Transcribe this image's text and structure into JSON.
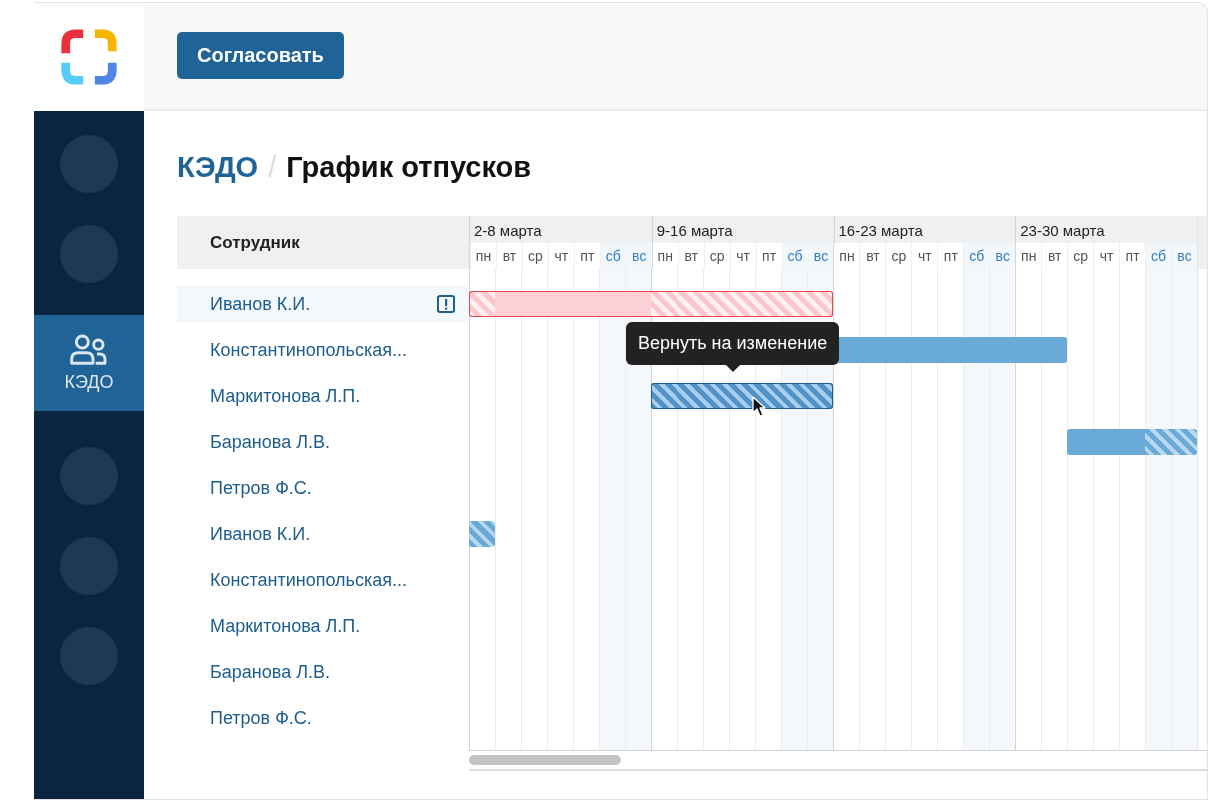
{
  "toolbar": {
    "button": "Согласовать"
  },
  "sidebar": {
    "items": [
      {
        "kind": "placeholder",
        "selected": false
      },
      {
        "kind": "placeholder",
        "selected": false
      },
      {
        "kind": "item",
        "label": "КЭДО",
        "selected": true
      },
      {
        "kind": "placeholder",
        "selected": false
      },
      {
        "kind": "placeholder",
        "selected": false
      },
      {
        "kind": "placeholder",
        "selected": false
      }
    ]
  },
  "breadcrumb": {
    "section": "КЭДО",
    "separator": "/",
    "title": "График отпусков"
  },
  "table": {
    "name_column": "Сотрудник",
    "weeks": [
      {
        "label": "2-8 марта",
        "days": [
          {
            "label": "пн",
            "weekend": false
          },
          {
            "label": "вт",
            "weekend": false
          },
          {
            "label": "ср",
            "weekend": false
          },
          {
            "label": "чт",
            "weekend": false
          },
          {
            "label": "пт",
            "weekend": false
          },
          {
            "label": "сб",
            "weekend": true
          },
          {
            "label": "вс",
            "weekend": true
          }
        ]
      },
      {
        "label": "9-16 марта",
        "days": [
          {
            "label": "пн",
            "weekend": false
          },
          {
            "label": "вт",
            "weekend": false
          },
          {
            "label": "ср",
            "weekend": false
          },
          {
            "label": "чт",
            "weekend": false
          },
          {
            "label": "пт",
            "weekend": false
          },
          {
            "label": "сб",
            "weekend": true
          },
          {
            "label": "вс",
            "weekend": true
          }
        ]
      },
      {
        "label": "16-23 марта",
        "days": [
          {
            "label": "пн",
            "weekend": false
          },
          {
            "label": "вт",
            "weekend": false
          },
          {
            "label": "ср",
            "weekend": false
          },
          {
            "label": "чт",
            "weekend": false
          },
          {
            "label": "пт",
            "weekend": false
          },
          {
            "label": "сб",
            "weekend": true
          },
          {
            "label": "вс",
            "weekend": true
          }
        ]
      },
      {
        "label": "23-30 марта",
        "days": [
          {
            "label": "пн",
            "weekend": false
          },
          {
            "label": "вт",
            "weekend": false
          },
          {
            "label": "ср",
            "weekend": false
          },
          {
            "label": "чт",
            "weekend": false
          },
          {
            "label": "пт",
            "weekend": false
          },
          {
            "label": "сб",
            "weekend": true
          },
          {
            "label": "вс",
            "weekend": true
          }
        ]
      }
    ],
    "rows": [
      {
        "name": "Иванов К.И.",
        "selected": true,
        "flagged": true,
        "conflict": true,
        "bar_selected": false,
        "cells": [
          {
            "vacation": true,
            "hatched": true
          },
          {
            "vacation": true,
            "hatched": false
          },
          {
            "vacation": true,
            "hatched": false
          },
          {
            "vacation": true,
            "hatched": false
          },
          {
            "vacation": true,
            "hatched": false
          },
          {
            "vacation": true,
            "hatched": false
          },
          {
            "vacation": true,
            "hatched": false
          },
          {
            "vacation": true,
            "hatched": true
          },
          {
            "vacation": true,
            "hatched": true
          },
          {
            "vacation": true,
            "hatched": true
          },
          {
            "vacation": true,
            "hatched": true
          },
          {
            "vacation": true,
            "hatched": true
          },
          {
            "vacation": true,
            "hatched": true
          },
          {
            "vacation": true,
            "hatched": true
          },
          {
            "vacation": false
          },
          {
            "vacation": false
          },
          {
            "vacation": false
          },
          {
            "vacation": false
          },
          {
            "vacation": false
          },
          {
            "vacation": false
          },
          {
            "vacation": false
          },
          {
            "vacation": false
          },
          {
            "vacation": false
          },
          {
            "vacation": false
          },
          {
            "vacation": false
          },
          {
            "vacation": false
          },
          {
            "vacation": false
          },
          {
            "vacation": false
          }
        ]
      },
      {
        "name": "Константинопольская...",
        "selected": false,
        "flagged": false,
        "conflict": false,
        "bar_selected": false,
        "cells": [
          {
            "vacation": false
          },
          {
            "vacation": false
          },
          {
            "vacation": false
          },
          {
            "vacation": false
          },
          {
            "vacation": false
          },
          {
            "vacation": false
          },
          {
            "vacation": false
          },
          {
            "vacation": false
          },
          {
            "vacation": false
          },
          {
            "vacation": false
          },
          {
            "vacation": false
          },
          {
            "vacation": false
          },
          {
            "vacation": false
          },
          {
            "vacation": false
          },
          {
            "vacation": true,
            "hatched": false
          },
          {
            "vacation": true,
            "hatched": false
          },
          {
            "vacation": true,
            "hatched": false
          },
          {
            "vacation": true,
            "hatched": false
          },
          {
            "vacation": true,
            "hatched": false
          },
          {
            "vacation": true,
            "hatched": false
          },
          {
            "vacation": true,
            "hatched": false
          },
          {
            "vacation": true,
            "hatched": false
          },
          {
            "vacation": true,
            "hatched": false
          },
          {
            "vacation": false
          },
          {
            "vacation": false
          },
          {
            "vacation": false
          },
          {
            "vacation": false
          },
          {
            "vacation": false
          }
        ]
      },
      {
        "name": "Маркитонова Л.П.",
        "selected": false,
        "flagged": false,
        "conflict": false,
        "bar_selected": true,
        "cells": [
          {
            "vacation": false
          },
          {
            "vacation": false
          },
          {
            "vacation": false
          },
          {
            "vacation": false
          },
          {
            "vacation": false
          },
          {
            "vacation": false
          },
          {
            "vacation": false
          },
          {
            "vacation": true,
            "hatched": true
          },
          {
            "vacation": true,
            "hatched": true
          },
          {
            "vacation": true,
            "hatched": true
          },
          {
            "vacation": true,
            "hatched": true
          },
          {
            "vacation": true,
            "hatched": true
          },
          {
            "vacation": true,
            "hatched": true
          },
          {
            "vacation": true,
            "hatched": true
          },
          {
            "vacation": false
          },
          {
            "vacation": false
          },
          {
            "vacation": false
          },
          {
            "vacation": false
          },
          {
            "vacation": false
          },
          {
            "vacation": false
          },
          {
            "vacation": false
          },
          {
            "vacation": false
          },
          {
            "vacation": false
          },
          {
            "vacation": false
          },
          {
            "vacation": false
          },
          {
            "vacation": false
          },
          {
            "vacation": false
          },
          {
            "vacation": false
          }
        ]
      },
      {
        "name": "Баранова Л.В.",
        "selected": false,
        "flagged": false,
        "conflict": false,
        "bar_selected": false,
        "cells": [
          {
            "vacation": false
          },
          {
            "vacation": false
          },
          {
            "vacation": false
          },
          {
            "vacation": false
          },
          {
            "vacation": false
          },
          {
            "vacation": false
          },
          {
            "vacation": false
          },
          {
            "vacation": false
          },
          {
            "vacation": false
          },
          {
            "vacation": false
          },
          {
            "vacation": false
          },
          {
            "vacation": false
          },
          {
            "vacation": false
          },
          {
            "vacation": false
          },
          {
            "vacation": false
          },
          {
            "vacation": false
          },
          {
            "vacation": false
          },
          {
            "vacation": false
          },
          {
            "vacation": false
          },
          {
            "vacation": false
          },
          {
            "vacation": false
          },
          {
            "vacation": false
          },
          {
            "vacation": false
          },
          {
            "vacation": true,
            "hatched": false
          },
          {
            "vacation": true,
            "hatched": false
          },
          {
            "vacation": true,
            "hatched": false
          },
          {
            "vacation": true,
            "hatched": true
          },
          {
            "vacation": true,
            "hatched": true
          }
        ]
      },
      {
        "name": "Петров Ф.С.",
        "selected": false,
        "flagged": false
      },
      {
        "name": "Иванов К.И.",
        "selected": false,
        "flagged": false,
        "conflict": false,
        "bar_selected": false,
        "cells": [
          {
            "vacation": true,
            "hatched": true
          },
          {
            "vacation": false
          },
          {
            "vacation": false
          },
          {
            "vacation": false
          },
          {
            "vacation": false
          },
          {
            "vacation": false
          },
          {
            "vacation": false
          },
          {
            "vacation": false
          },
          {
            "vacation": false
          },
          {
            "vacation": false
          },
          {
            "vacation": false
          },
          {
            "vacation": false
          },
          {
            "vacation": false
          },
          {
            "vacation": false
          },
          {
            "vacation": false
          },
          {
            "vacation": false
          },
          {
            "vacation": false
          },
          {
            "vacation": false
          },
          {
            "vacation": false
          },
          {
            "vacation": false
          },
          {
            "vacation": false
          },
          {
            "vacation": false
          },
          {
            "vacation": false
          },
          {
            "vacation": false
          },
          {
            "vacation": false
          },
          {
            "vacation": false
          },
          {
            "vacation": false
          },
          {
            "vacation": false
          }
        ]
      },
      {
        "name": "Константинопольская...",
        "selected": false,
        "flagged": false
      },
      {
        "name": "Маркитонова Л.П.",
        "selected": false,
        "flagged": false
      },
      {
        "name": "Баранова Л.В.",
        "selected": false,
        "flagged": false
      },
      {
        "name": "Петров Ф.С.",
        "selected": false,
        "flagged": false
      }
    ],
    "tooltip": {
      "text": "Вернуть на изменение"
    }
  }
}
